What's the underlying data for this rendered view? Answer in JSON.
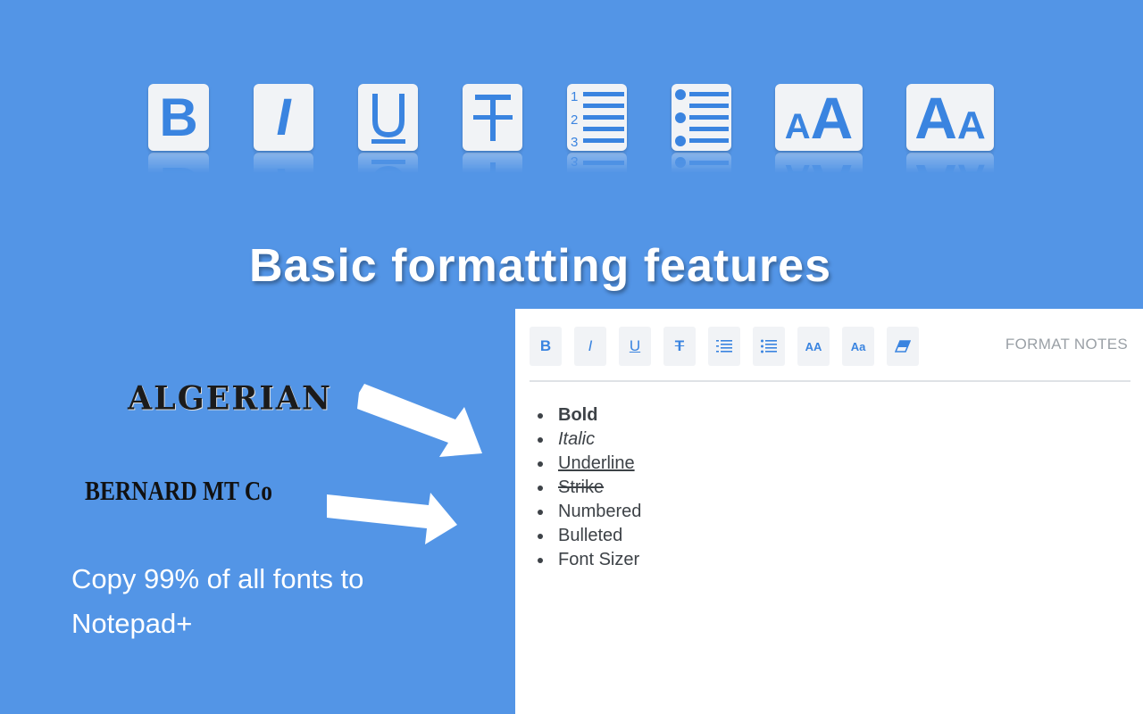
{
  "big_icons": [
    {
      "name": "bold-icon",
      "glyph": "B"
    },
    {
      "name": "italic-icon",
      "glyph": "I"
    },
    {
      "name": "underline-icon",
      "glyph": "U"
    },
    {
      "name": "strikethrough-icon",
      "glyph": "T"
    },
    {
      "name": "numbered-list-icon",
      "glyph": "numbered-list"
    },
    {
      "name": "bulleted-list-icon",
      "glyph": "bulleted-list"
    },
    {
      "name": "font-size-increase-icon",
      "glyph": "AA"
    },
    {
      "name": "font-size-decrease-icon",
      "glyph": "Aa"
    }
  ],
  "headline": "Basic formatting features",
  "font_samples": {
    "algerian": "ALGERIAN",
    "bernard": "BERNARD MT Co"
  },
  "copy_text": "Copy 99% of all fonts to Notepad+",
  "editor": {
    "toolbar": {
      "bold": "B",
      "italic": "I",
      "underline": "U",
      "strike": "T",
      "font_up": "AA",
      "font_down": "Aa",
      "format_notes": "FORMAT NOTES"
    },
    "list": [
      "Bold",
      "Italic",
      "Underline",
      "Strike",
      "Numbered",
      "Bulleted",
      "Font Sizer"
    ]
  },
  "colors": {
    "background": "#5395e6",
    "icon_blue": "#3a84e0",
    "icon_tile": "#f1f3f6",
    "panel": "#ffffff"
  }
}
